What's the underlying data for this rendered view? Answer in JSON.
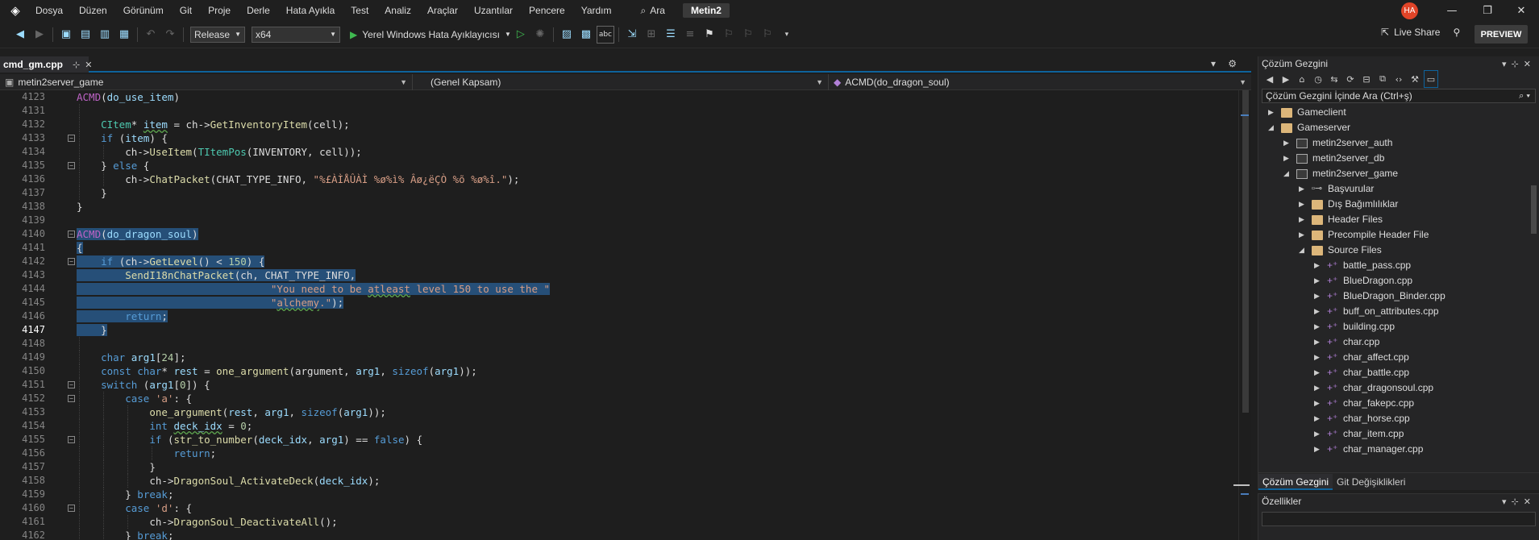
{
  "menu": {
    "items": [
      "Dosya",
      "Düzen",
      "Görünüm",
      "Git",
      "Proje",
      "Derle",
      "Hata Ayıkla",
      "Test",
      "Analiz",
      "Araçlar",
      "Uzantılar",
      "Pencere",
      "Yardım"
    ],
    "search": "Ara",
    "project_badge": "Metin2",
    "avatar": "HA"
  },
  "toolbar": {
    "config": "Release",
    "platform": "x64",
    "run_label": "Yerel Windows Hata Ayıklayıcısı",
    "live_share": "Live Share",
    "preview": "PREVIEW"
  },
  "editor": {
    "tab": "cmd_gm.cpp",
    "nav": {
      "project": "metin2server_game",
      "scope": "(Genel Kapsam)",
      "member": "ACMD(do_dragon_soul)"
    }
  },
  "code_lines": [
    {
      "n": "4123",
      "h": "<span class=\"mac\">ACMD</span>(<span class=\"var\">do_use_item</span>)",
      "f": "",
      "i": 0
    },
    {
      "n": "4131",
      "h": "",
      "f": "",
      "i": 1
    },
    {
      "n": "4132",
      "h": "<span class=\"ty\">CItem</span>* <span class=\"var sq\">item</span> = ch-><span class=\"fn\">GetInventoryItem</span>(cell);",
      "f": "",
      "i": 1
    },
    {
      "n": "4133",
      "h": "<span class=\"kw\">if</span> (<span class=\"var\">item</span>) {",
      "f": "-",
      "i": 1
    },
    {
      "n": "4134",
      "h": "ch-><span class=\"fn\">UseItem</span>(<span class=\"ty\">TItemPos</span>(INVENTORY, cell));",
      "f": "",
      "i": 2
    },
    {
      "n": "4135",
      "h": "} <span class=\"kw\">else</span> {",
      "f": "-",
      "i": 1
    },
    {
      "n": "4136",
      "h": "ch-><span class=\"fn\">ChatPacket</span>(CHAT_TYPE_INFO, <span class=\"str\">\"%£ÀÌÅÛÀÌ %ø%ì% Âø¿ëÇÒ %õ %ø%î.\"</span>);",
      "f": "",
      "i": 2
    },
    {
      "n": "4137",
      "h": "}",
      "f": "",
      "i": 1
    },
    {
      "n": "4138",
      "h": "}",
      "f": "",
      "i": 0
    },
    {
      "n": "4139",
      "h": "",
      "f": "",
      "i": 0
    },
    {
      "n": "4140",
      "h": "<span class=\"sel\"><span class=\"mac\">ACMD</span>(<span class=\"var\">do_dragon_soul</span>)</span>",
      "f": "-",
      "i": 0
    },
    {
      "n": "4141",
      "h": "<span class=\"sel\">{</span>",
      "f": "",
      "i": 0
    },
    {
      "n": "4142",
      "h": "<span class=\"sel\">    <span class=\"kw\">if</span> (ch-><span class=\"fn\">GetLevel</span>() &lt; <span class=\"num\">150</span>) {</span>",
      "f": "-",
      "i": 0
    },
    {
      "n": "4143",
      "h": "<span class=\"sel\">        <span class=\"fn\">SendI18nChatPacket</span>(ch, CHAT_TYPE_INFO,</span>",
      "f": "",
      "i": 0
    },
    {
      "n": "4144",
      "h": "<span class=\"sel\">                                <span class=\"str\">\"You need to be <span class=\"sq\">atleast</span> level 150 to use the \"</span></span>",
      "f": "",
      "i": 0
    },
    {
      "n": "4145",
      "h": "<span class=\"sel\">                                <span class=\"str\">\"<span class=\"sq\">alchemy</span>.\"</span>);</span>",
      "f": "",
      "i": 0
    },
    {
      "n": "4146",
      "h": "<span class=\"sel\">        <span class=\"kw\">return</span>;</span>",
      "f": "",
      "i": 0
    },
    {
      "n": "4147",
      "h": "<span class=\"sel\">    }</span>",
      "f": "",
      "i": 0,
      "cur": true
    },
    {
      "n": "4148",
      "h": "",
      "f": "",
      "i": 1
    },
    {
      "n": "4149",
      "h": "<span class=\"kw\">char</span> <span class=\"var\">arg1</span>[<span class=\"num\">24</span>];",
      "f": "",
      "i": 1
    },
    {
      "n": "4150",
      "h": "<span class=\"kw\">const char</span>* <span class=\"var\">rest</span> = <span class=\"fn\">one_argument</span>(argument, <span class=\"var\">arg1</span>, <span class=\"kw\">sizeof</span>(<span class=\"var\">arg1</span>));",
      "f": "",
      "i": 1
    },
    {
      "n": "4151",
      "h": "<span class=\"kw\">switch</span> (<span class=\"var\">arg1</span>[<span class=\"num\">0</span>]) {",
      "f": "-",
      "i": 1
    },
    {
      "n": "4152",
      "h": "<span class=\"kw\">case</span> <span class=\"str\">'a'</span>: {",
      "f": "-",
      "i": 2
    },
    {
      "n": "4153",
      "h": "<span class=\"fn\">one_argument</span>(<span class=\"var\">rest</span>, <span class=\"var\">arg1</span>, <span class=\"kw\">sizeof</span>(<span class=\"var\">arg1</span>));",
      "f": "",
      "i": 3
    },
    {
      "n": "4154",
      "h": "<span class=\"kw\">int</span> <span class=\"var sq\">deck_idx</span> = <span class=\"num\">0</span>;",
      "f": "",
      "i": 3
    },
    {
      "n": "4155",
      "h": "<span class=\"kw\">if</span> (<span class=\"fn\">str_to_number</span>(<span class=\"var\">deck_idx</span>, <span class=\"var\">arg1</span>) == <span class=\"kw\">false</span>) {",
      "f": "-",
      "i": 3
    },
    {
      "n": "4156",
      "h": "<span class=\"kw\">return</span>;",
      "f": "",
      "i": 4
    },
    {
      "n": "4157",
      "h": "}",
      "f": "",
      "i": 3
    },
    {
      "n": "4158",
      "h": "ch-><span class=\"fn\">DragonSoul_ActivateDeck</span>(<span class=\"var\">deck_idx</span>);",
      "f": "",
      "i": 3
    },
    {
      "n": "4159",
      "h": "} <span class=\"kw\">break</span>;",
      "f": "",
      "i": 2
    },
    {
      "n": "4160",
      "h": "<span class=\"kw\">case</span> <span class=\"str\">'d'</span>: {",
      "f": "-",
      "i": 2
    },
    {
      "n": "4161",
      "h": "ch-><span class=\"fn\">DragonSoul_DeactivateAll</span>();",
      "f": "",
      "i": 3
    },
    {
      "n": "4162",
      "h": "} <span class=\"kw\">break</span>;",
      "f": "",
      "i": 2
    }
  ],
  "solution": {
    "title": "Çözüm Gezgini",
    "search_placeholder": "Çözüm Gezgini İçinde Ara (Ctrl+ş)",
    "nodes": [
      {
        "label": "Gameclient",
        "depth": 0,
        "icon": "folder",
        "arrow": "▶"
      },
      {
        "label": "Gameserver",
        "depth": 0,
        "icon": "folder",
        "arrow": "◢"
      },
      {
        "label": "metin2server_auth",
        "depth": 1,
        "icon": "proj",
        "arrow": "▶"
      },
      {
        "label": "metin2server_db",
        "depth": 1,
        "icon": "proj",
        "arrow": "▶"
      },
      {
        "label": "metin2server_game",
        "depth": 1,
        "icon": "proj",
        "arrow": "◢"
      },
      {
        "label": "Başvurular",
        "depth": 2,
        "icon": "ref",
        "arrow": "▶"
      },
      {
        "label": "Dış Bağımlılıklar",
        "depth": 2,
        "icon": "folder",
        "arrow": "▶"
      },
      {
        "label": "Header Files",
        "depth": 2,
        "icon": "folder",
        "arrow": "▶"
      },
      {
        "label": "Precompile Header File",
        "depth": 2,
        "icon": "folder",
        "arrow": "▶"
      },
      {
        "label": "Source Files",
        "depth": 2,
        "icon": "folder",
        "arrow": "◢"
      },
      {
        "label": "battle_pass.cpp",
        "depth": 3,
        "icon": "cpp",
        "arrow": "▶"
      },
      {
        "label": "BlueDragon.cpp",
        "depth": 3,
        "icon": "cpp",
        "arrow": "▶"
      },
      {
        "label": "BlueDragon_Binder.cpp",
        "depth": 3,
        "icon": "cpp",
        "arrow": "▶"
      },
      {
        "label": "buff_on_attributes.cpp",
        "depth": 3,
        "icon": "cpp",
        "arrow": "▶"
      },
      {
        "label": "building.cpp",
        "depth": 3,
        "icon": "cpp",
        "arrow": "▶"
      },
      {
        "label": "char.cpp",
        "depth": 3,
        "icon": "cpp",
        "arrow": "▶"
      },
      {
        "label": "char_affect.cpp",
        "depth": 3,
        "icon": "cpp",
        "arrow": "▶"
      },
      {
        "label": "char_battle.cpp",
        "depth": 3,
        "icon": "cpp",
        "arrow": "▶"
      },
      {
        "label": "char_dragonsoul.cpp",
        "depth": 3,
        "icon": "cpp",
        "arrow": "▶"
      },
      {
        "label": "char_fakepc.cpp",
        "depth": 3,
        "icon": "cpp",
        "arrow": "▶"
      },
      {
        "label": "char_horse.cpp",
        "depth": 3,
        "icon": "cpp",
        "arrow": "▶"
      },
      {
        "label": "char_item.cpp",
        "depth": 3,
        "icon": "cpp",
        "arrow": "▶"
      },
      {
        "label": "char_manager.cpp",
        "depth": 3,
        "icon": "cpp",
        "arrow": "▶"
      }
    ],
    "tabs": [
      "Çözüm Gezgini",
      "Git Değişiklikleri"
    ]
  },
  "properties": {
    "title": "Özellikler"
  },
  "colors": {
    "accent": "#0e639c",
    "selection": "#264f78",
    "run": "#3fb950",
    "avatar": "#e04428"
  }
}
